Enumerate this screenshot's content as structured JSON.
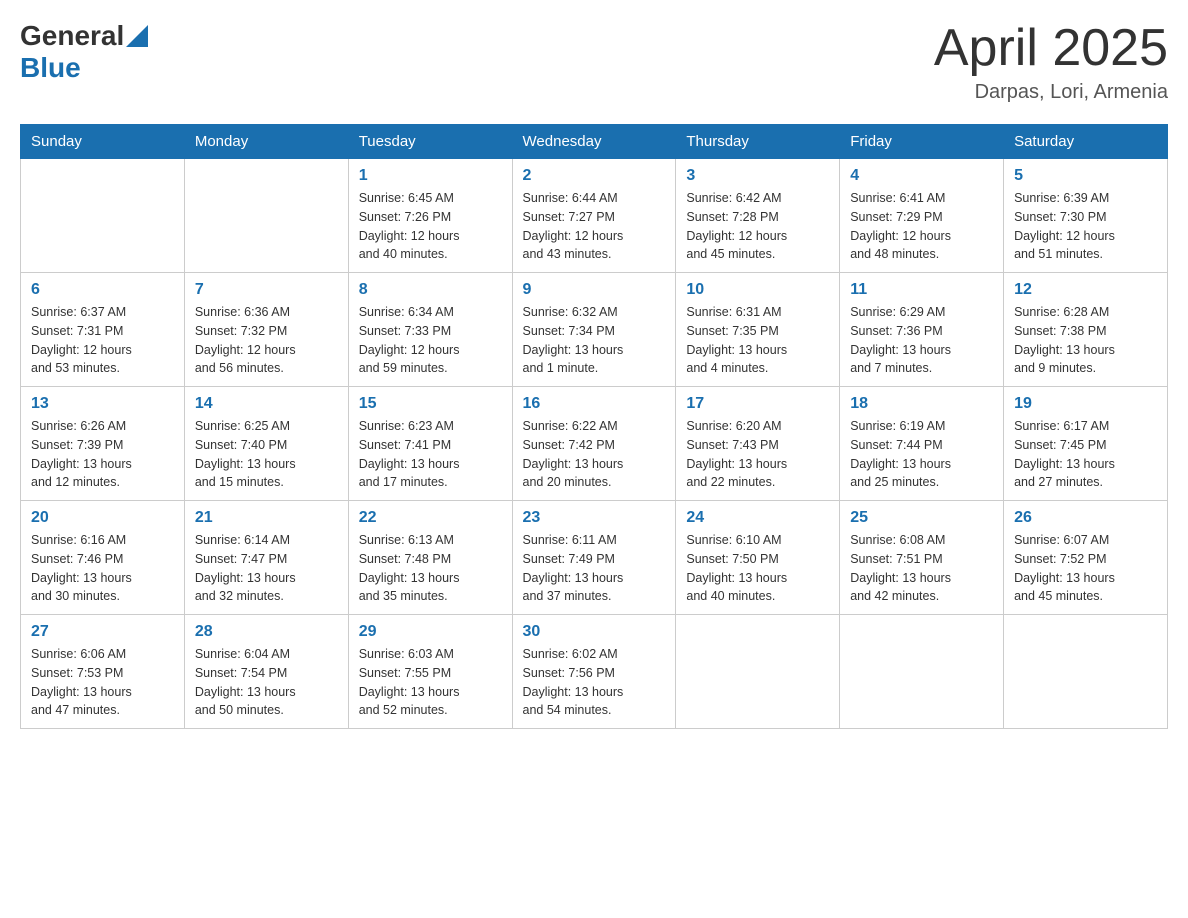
{
  "header": {
    "logo_general": "General",
    "logo_blue": "Blue",
    "title": "April 2025",
    "location": "Darpas, Lori, Armenia"
  },
  "days_of_week": [
    "Sunday",
    "Monday",
    "Tuesday",
    "Wednesday",
    "Thursday",
    "Friday",
    "Saturday"
  ],
  "weeks": [
    [
      {
        "day": "",
        "info": ""
      },
      {
        "day": "",
        "info": ""
      },
      {
        "day": "1",
        "info": "Sunrise: 6:45 AM\nSunset: 7:26 PM\nDaylight: 12 hours\nand 40 minutes."
      },
      {
        "day": "2",
        "info": "Sunrise: 6:44 AM\nSunset: 7:27 PM\nDaylight: 12 hours\nand 43 minutes."
      },
      {
        "day": "3",
        "info": "Sunrise: 6:42 AM\nSunset: 7:28 PM\nDaylight: 12 hours\nand 45 minutes."
      },
      {
        "day": "4",
        "info": "Sunrise: 6:41 AM\nSunset: 7:29 PM\nDaylight: 12 hours\nand 48 minutes."
      },
      {
        "day": "5",
        "info": "Sunrise: 6:39 AM\nSunset: 7:30 PM\nDaylight: 12 hours\nand 51 minutes."
      }
    ],
    [
      {
        "day": "6",
        "info": "Sunrise: 6:37 AM\nSunset: 7:31 PM\nDaylight: 12 hours\nand 53 minutes."
      },
      {
        "day": "7",
        "info": "Sunrise: 6:36 AM\nSunset: 7:32 PM\nDaylight: 12 hours\nand 56 minutes."
      },
      {
        "day": "8",
        "info": "Sunrise: 6:34 AM\nSunset: 7:33 PM\nDaylight: 12 hours\nand 59 minutes."
      },
      {
        "day": "9",
        "info": "Sunrise: 6:32 AM\nSunset: 7:34 PM\nDaylight: 13 hours\nand 1 minute."
      },
      {
        "day": "10",
        "info": "Sunrise: 6:31 AM\nSunset: 7:35 PM\nDaylight: 13 hours\nand 4 minutes."
      },
      {
        "day": "11",
        "info": "Sunrise: 6:29 AM\nSunset: 7:36 PM\nDaylight: 13 hours\nand 7 minutes."
      },
      {
        "day": "12",
        "info": "Sunrise: 6:28 AM\nSunset: 7:38 PM\nDaylight: 13 hours\nand 9 minutes."
      }
    ],
    [
      {
        "day": "13",
        "info": "Sunrise: 6:26 AM\nSunset: 7:39 PM\nDaylight: 13 hours\nand 12 minutes."
      },
      {
        "day": "14",
        "info": "Sunrise: 6:25 AM\nSunset: 7:40 PM\nDaylight: 13 hours\nand 15 minutes."
      },
      {
        "day": "15",
        "info": "Sunrise: 6:23 AM\nSunset: 7:41 PM\nDaylight: 13 hours\nand 17 minutes."
      },
      {
        "day": "16",
        "info": "Sunrise: 6:22 AM\nSunset: 7:42 PM\nDaylight: 13 hours\nand 20 minutes."
      },
      {
        "day": "17",
        "info": "Sunrise: 6:20 AM\nSunset: 7:43 PM\nDaylight: 13 hours\nand 22 minutes."
      },
      {
        "day": "18",
        "info": "Sunrise: 6:19 AM\nSunset: 7:44 PM\nDaylight: 13 hours\nand 25 minutes."
      },
      {
        "day": "19",
        "info": "Sunrise: 6:17 AM\nSunset: 7:45 PM\nDaylight: 13 hours\nand 27 minutes."
      }
    ],
    [
      {
        "day": "20",
        "info": "Sunrise: 6:16 AM\nSunset: 7:46 PM\nDaylight: 13 hours\nand 30 minutes."
      },
      {
        "day": "21",
        "info": "Sunrise: 6:14 AM\nSunset: 7:47 PM\nDaylight: 13 hours\nand 32 minutes."
      },
      {
        "day": "22",
        "info": "Sunrise: 6:13 AM\nSunset: 7:48 PM\nDaylight: 13 hours\nand 35 minutes."
      },
      {
        "day": "23",
        "info": "Sunrise: 6:11 AM\nSunset: 7:49 PM\nDaylight: 13 hours\nand 37 minutes."
      },
      {
        "day": "24",
        "info": "Sunrise: 6:10 AM\nSunset: 7:50 PM\nDaylight: 13 hours\nand 40 minutes."
      },
      {
        "day": "25",
        "info": "Sunrise: 6:08 AM\nSunset: 7:51 PM\nDaylight: 13 hours\nand 42 minutes."
      },
      {
        "day": "26",
        "info": "Sunrise: 6:07 AM\nSunset: 7:52 PM\nDaylight: 13 hours\nand 45 minutes."
      }
    ],
    [
      {
        "day": "27",
        "info": "Sunrise: 6:06 AM\nSunset: 7:53 PM\nDaylight: 13 hours\nand 47 minutes."
      },
      {
        "day": "28",
        "info": "Sunrise: 6:04 AM\nSunset: 7:54 PM\nDaylight: 13 hours\nand 50 minutes."
      },
      {
        "day": "29",
        "info": "Sunrise: 6:03 AM\nSunset: 7:55 PM\nDaylight: 13 hours\nand 52 minutes."
      },
      {
        "day": "30",
        "info": "Sunrise: 6:02 AM\nSunset: 7:56 PM\nDaylight: 13 hours\nand 54 minutes."
      },
      {
        "day": "",
        "info": ""
      },
      {
        "day": "",
        "info": ""
      },
      {
        "day": "",
        "info": ""
      }
    ]
  ]
}
